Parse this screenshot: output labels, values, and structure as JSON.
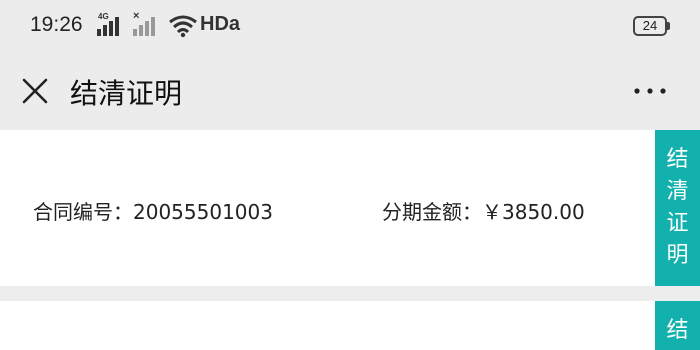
{
  "status_bar": {
    "time": "19:26",
    "network_label": "4G",
    "no_signal_mark": "×",
    "hd_label": "HDa",
    "battery": "24"
  },
  "nav": {
    "title": "结清证明",
    "close_icon": "close-icon",
    "more_icon": "more-horizontal-icon"
  },
  "records": [
    {
      "contract_label": "合同编号：",
      "contract_no": "20055501003",
      "amount_label": "分期金额：",
      "amount": "￥3850.00",
      "action_chars": [
        "结",
        "清",
        "证",
        "明"
      ]
    },
    {
      "action_chars": [
        "结"
      ]
    }
  ],
  "colors": {
    "accent": "#12b1ad",
    "background": "#ededed",
    "card": "#ffffff"
  }
}
